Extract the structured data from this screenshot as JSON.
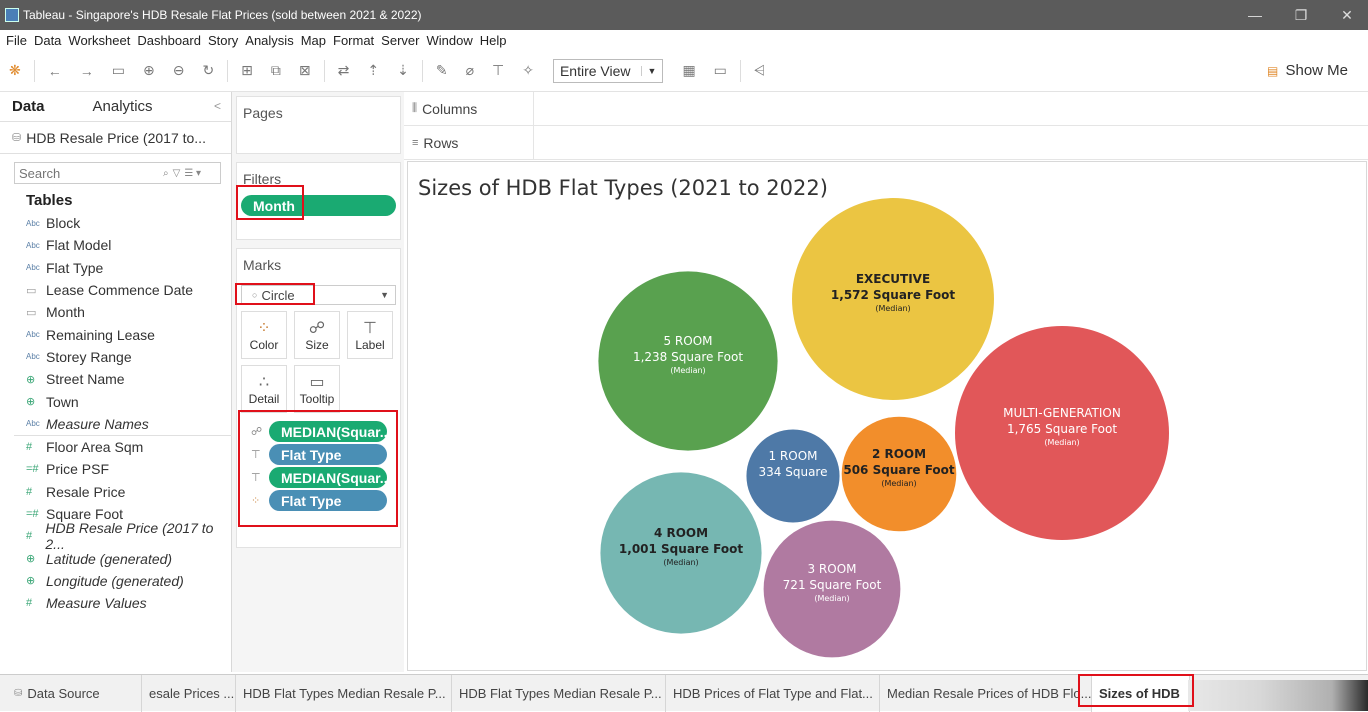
{
  "window": {
    "title": "Tableau - Singapore's HDB Resale Flat Prices (sold between 2021 & 2022)",
    "controls": [
      "—",
      "❐",
      "✕"
    ]
  },
  "menu": [
    "File",
    "Data",
    "Worksheet",
    "Dashboard",
    "Story",
    "Analysis",
    "Map",
    "Format",
    "Server",
    "Window",
    "Help"
  ],
  "toolbar": {
    "fit_value": "Entire View",
    "show_me_label": "Show Me"
  },
  "data_pane": {
    "tab_data": "Data",
    "tab_analytics": "Analytics",
    "datasource": "HDB Resale Price (2017 to...",
    "search_placeholder": "Search",
    "tables_heading": "Tables",
    "dimensions": [
      {
        "type": "Abc",
        "name": "Block"
      },
      {
        "type": "Abc",
        "name": "Flat Model"
      },
      {
        "type": "Abc",
        "name": "Flat Type"
      },
      {
        "type": "date",
        "name": "Lease Commence Date"
      },
      {
        "type": "date",
        "name": "Month"
      },
      {
        "type": "Abc",
        "name": "Remaining Lease"
      },
      {
        "type": "Abc",
        "name": "Storey Range"
      },
      {
        "type": "geo",
        "name": "Street Name"
      },
      {
        "type": "geo",
        "name": "Town"
      },
      {
        "type": "Abc",
        "name": "Measure Names"
      }
    ],
    "measures": [
      {
        "type": "#",
        "name": "Floor Area Sqm"
      },
      {
        "type": "=#",
        "name": "Price PSF"
      },
      {
        "type": "#",
        "name": "Resale Price"
      },
      {
        "type": "=#",
        "name": "Square Foot"
      },
      {
        "type": "#",
        "name": "HDB Resale Price (2017 to 2..."
      },
      {
        "type": "geo",
        "name": "Latitude (generated)"
      },
      {
        "type": "geo",
        "name": "Longitude (generated)"
      },
      {
        "type": "#",
        "name": "Measure Values"
      }
    ]
  },
  "cards": {
    "pages_title": "Pages",
    "filters_title": "Filters",
    "filter_pill": "Month",
    "marks_title": "Marks",
    "mark_type": "Circle",
    "mark_buttons": [
      "Color",
      "Size",
      "Label",
      "Detail",
      "Tooltip"
    ],
    "mark_pills": [
      {
        "icon": "size",
        "label": "MEDIAN(Squar..",
        "color": "green"
      },
      {
        "icon": "label",
        "label": "Flat Type",
        "color": "blue"
      },
      {
        "icon": "label",
        "label": "MEDIAN(Squar..",
        "color": "green"
      },
      {
        "icon": "color",
        "label": "Flat Type",
        "color": "blue"
      }
    ]
  },
  "shelves": {
    "columns_label": "Columns",
    "rows_label": "Rows"
  },
  "viz": {
    "title": "Sizes of HDB Flat Types (2021 to 2022)"
  },
  "chart_data": {
    "type": "bubble",
    "title": "Sizes of HDB Flat Types (2021 to 2022)",
    "measure": "MEDIAN(Square Foot)",
    "bubbles": [
      {
        "name": "EXECUTIVE",
        "label": "1,572 Square Foot",
        "sub": "(Median)",
        "value": 1572,
        "color": "#ebc542",
        "text_color": "#222222"
      },
      {
        "name": "5 ROOM",
        "label": "1,238 Square Foot",
        "sub": "(Median)",
        "value": 1238,
        "color": "#59a14f",
        "text_color": "#ffffff"
      },
      {
        "name": "MULTI-GENERATION",
        "label": "1,765 Square Foot",
        "sub": "(Median)",
        "value": 1765,
        "color": "#e15759",
        "text_color": "#ffffff"
      },
      {
        "name": "1 ROOM",
        "label": "334 Square",
        "sub": "",
        "value": 334,
        "color": "#4e79a7",
        "text_color": "#ffffff"
      },
      {
        "name": "2 ROOM",
        "label": "506 Square Foot",
        "sub": "(Median)",
        "value": 506,
        "color": "#f28e2b",
        "text_color": "#222222"
      },
      {
        "name": "4 ROOM",
        "label": "1,001 Square Foot",
        "sub": "(Median)",
        "value": 1001,
        "color": "#76b7b2",
        "text_color": "#222222"
      },
      {
        "name": "3 ROOM",
        "label": "721 Square Foot",
        "sub": "(Median)",
        "value": 721,
        "color": "#b07aa1",
        "text_color": "#ffffff"
      }
    ]
  },
  "sheet_tabs": [
    "Data Source",
    "esale Prices ...",
    "HDB Flat Types Median Resale P...",
    "HDB Flat Types Median Resale P...",
    "HDB Prices of Flat Type and Flat...",
    "Median Resale Prices of HDB Flo...",
    "Sizes of HDB"
  ]
}
